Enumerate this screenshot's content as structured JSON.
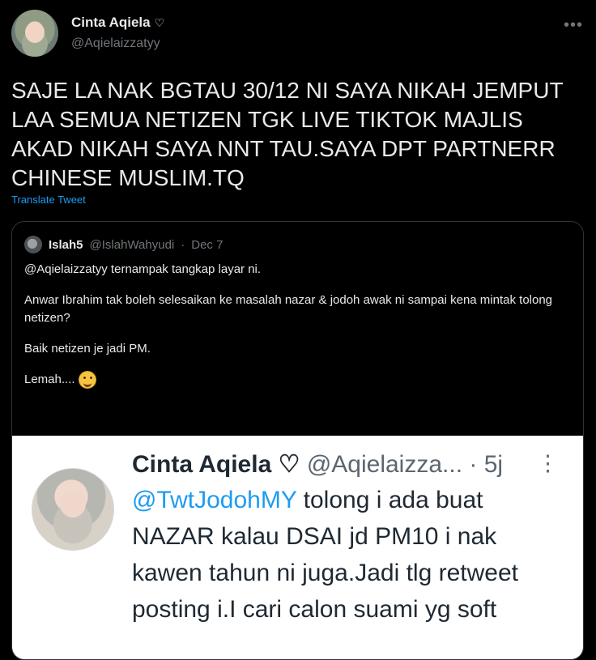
{
  "tweet": {
    "author_name": "Cinta Aqiela",
    "heart_symbol": "♡",
    "author_handle": "@Aqielaizzatyy",
    "more_icon": "more-icon",
    "text": "SAJE LA NAK BGTAU 30/12 NI SAYA NIKAH JEMPUT LAA SEMUA NETIZEN TGK LIVE TIKTOK MAJLIS AKAD NIKAH SAYA NNT TAU.SAYA DPT PARTNERR CHINESE MUSLIM.TQ",
    "translate_label": "Translate Tweet"
  },
  "quote": {
    "author_name": "Islah5",
    "author_handle": "@IslahWahyudi",
    "separator": "·",
    "date": "Dec 7",
    "paragraphs": [
      "@Aqielaizzatyy ternampak tangkap layar ni.",
      "Anwar Ibrahim tak boleh selesaikan ke masalah nazar & jodoh awak ni sampai kena mintak tolong netizen?",
      "Baik netizen je jadi PM.",
      "Lemah...."
    ],
    "emoji_icon": "sweat-smile-emoji-icon"
  },
  "embedded_screenshot": {
    "name": "Cinta Aqiela ♡",
    "handle": "@Aqielaizza...",
    "time": "· 5j",
    "dots": "⋮",
    "mention": "@TwtJodohMY",
    "line1_rest": " tolong i ada buat",
    "line2": "NAZAR kalau DSAI jd PM10 i nak",
    "line3": "kawen tahun ni juga.Jadi tlg retweet",
    "line4": "posting i.I cari calon suami yg soft"
  }
}
